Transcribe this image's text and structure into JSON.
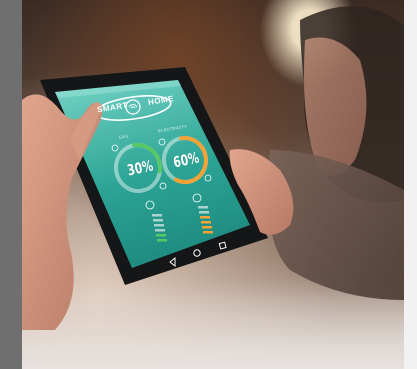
{
  "app": {
    "logo_left": "SMART",
    "logo_right": "HOME"
  },
  "gauges": [
    {
      "label": "GAS",
      "percent_text": "30%",
      "level": 0.3,
      "color": "#58c765"
    },
    {
      "label": "ELECTRICITY",
      "percent_text": "60%",
      "level": 0.6,
      "color": "#f4a235"
    }
  ],
  "colors": {
    "screen_top": "#6fd0c3",
    "screen_bottom": "#1f8d82",
    "gas": "#58c765",
    "electricity": "#f4a235"
  },
  "icons": [
    "wifi-icon",
    "back-icon",
    "home-icon",
    "recent-apps-icon",
    "power-icon"
  ]
}
